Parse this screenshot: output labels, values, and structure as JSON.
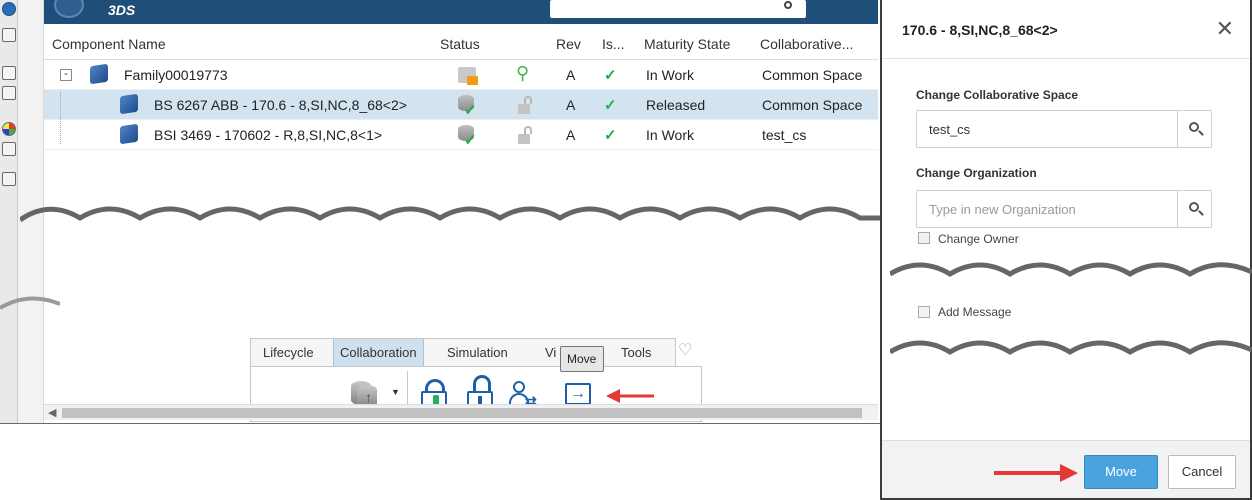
{
  "left_toolbar": {
    "icons": [
      "compass-icon",
      "cube-icon",
      "folder-icon",
      "properties-icon",
      "color-wheel-icon",
      "list-icon",
      "table-icon"
    ]
  },
  "topbar": {
    "bg_color": "#1f4e79"
  },
  "table": {
    "headers": [
      "Component Name",
      "Status",
      "Rev",
      "Is...",
      "Maturity State",
      "Collaborative..."
    ],
    "rows": [
      {
        "name": "Family00019773",
        "rev": "A",
        "maturity": "In Work",
        "space": "Common Space",
        "selected": false
      },
      {
        "name": "BS 6267 ABB - 170.6 - 8,SI,NC,8_68<2>",
        "rev": "A",
        "maturity": "Released",
        "space": "Common Space",
        "selected": true
      },
      {
        "name": "BSI 3469 - 170602 - R,8,SI,NC,8<1>",
        "rev": "A",
        "maturity": "In Work",
        "space": "test_cs",
        "selected": false
      }
    ]
  },
  "actionbar": {
    "tabs": [
      "Lifecycle",
      "Collaboration",
      "Simulation",
      "Vi",
      "Tools"
    ],
    "active_tab": "Collaboration",
    "tooltip": "Move"
  },
  "dialog": {
    "title": "170.6 - 8,SI,NC,8_68<2>",
    "space_label": "Change Collaborative Space",
    "space_value": "test_cs",
    "org_label": "Change Organization",
    "org_placeholder": "Type in new Organization",
    "owner_label": "Change Owner",
    "message_label": "Add Message",
    "move_label": "Move",
    "cancel_label": "Cancel"
  },
  "colors": {
    "accent": "#4aa3df",
    "selected_row": "#d3e4f0",
    "arrow_red": "#e53935",
    "check_green": "#1bb13f"
  }
}
